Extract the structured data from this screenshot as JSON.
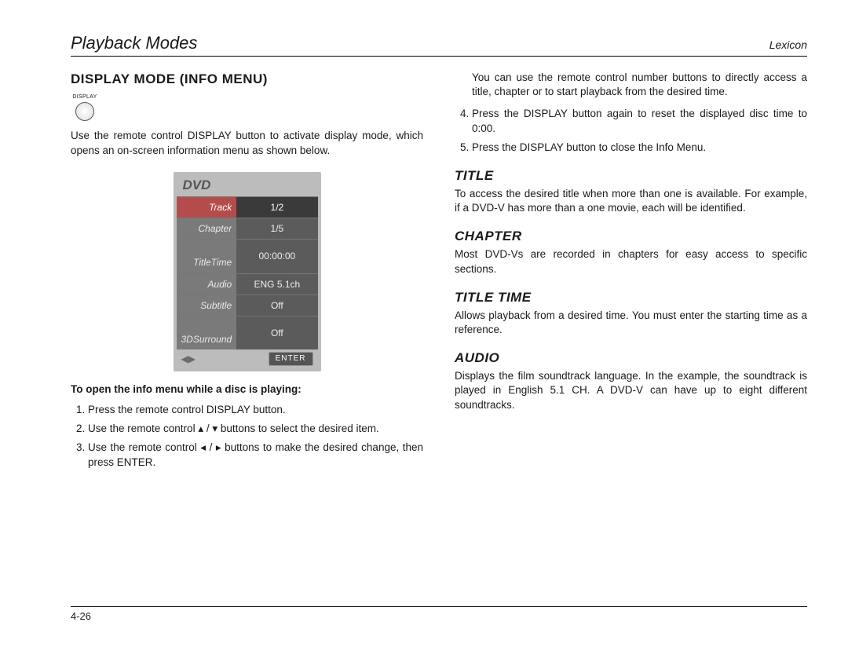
{
  "runhead": {
    "left": "Playback Modes",
    "right": "Lexicon"
  },
  "left": {
    "heading": "DISPLAY MODE (INFO MENU)",
    "display_label": "DISPLAY",
    "intro": "Use the remote control DISPLAY button to activate display mode, which opens an on-screen information menu as shown below.",
    "osd": {
      "title": "DVD",
      "rows": [
        {
          "label": "Track",
          "value": "1/2",
          "selected": true,
          "icon": "disc-icon"
        },
        {
          "label": "Chapter",
          "value": "1/5",
          "selected": false,
          "icon": "chapter-icon"
        },
        {
          "label": "TitleTime",
          "value": "00:00:00",
          "selected": false,
          "icon": "clock-icon"
        },
        {
          "label": "Audio",
          "value": "ENG 5.1ch",
          "selected": false,
          "icon": "speaker-icon"
        },
        {
          "label": "Subtitle",
          "value": "Off",
          "selected": false,
          "icon": "subtitle-icon"
        },
        {
          "label": "3DSurround",
          "value": "Off",
          "selected": false,
          "icon": "surround-icon"
        }
      ],
      "enter": "ENTER"
    },
    "steps_lead": "To open the info menu while a disc is playing:",
    "steps": [
      "Press the remote control DISPLAY button.",
      "Use the remote control ▴ / ▾ buttons to select the desired item.",
      "Use the remote control ◂ / ▸ buttons to make the desired change, then press ENTER."
    ]
  },
  "right": {
    "cont_para": "You can use the remote control number buttons to directly access a title, chapter or to start playback from the desired time.",
    "cont_steps": [
      "Press the DISPLAY button again to reset the displayed disc time to 0:00.",
      "Press the DISPLAY button to close the Info Menu."
    ],
    "sections": [
      {
        "title": "TITLE",
        "body": "To access the desired title when more than one is available. For example, if a DVD-V has more than a one movie, each will be identified."
      },
      {
        "title": "CHAPTER",
        "body": "Most DVD-Vs are recorded in chapters for easy access to specific sections."
      },
      {
        "title": "TITLE TIME",
        "body": "Allows playback from a desired time. You must enter the starting time as a reference."
      },
      {
        "title": "AUDIO",
        "body": "Displays the film soundtrack language. In the example, the soundtrack is played in English 5.1 CH. A DVD-V can have up to eight different soundtracks."
      }
    ]
  },
  "footer": {
    "page": "4-26"
  }
}
